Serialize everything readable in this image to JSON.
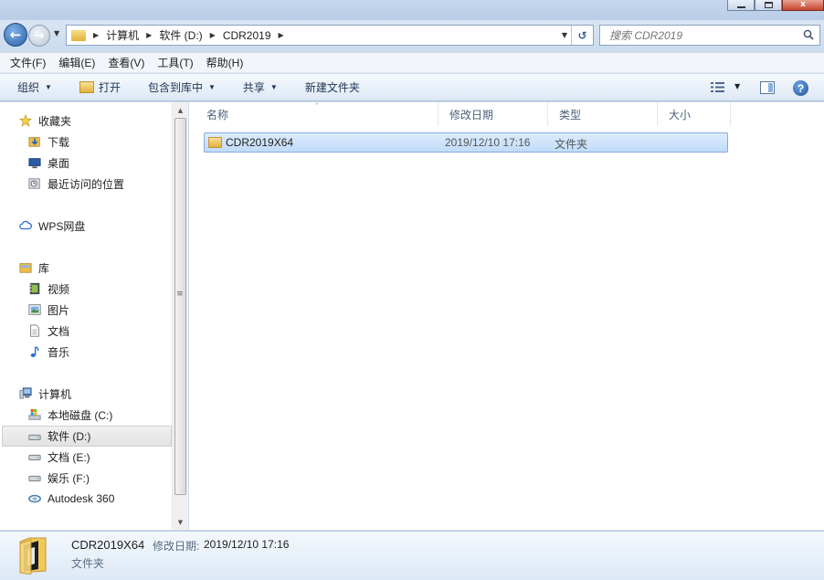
{
  "address": {
    "crumbs": [
      "计算机",
      "软件 (D:)",
      "CDR2019"
    ]
  },
  "search": {
    "placeholder": "搜索 CDR2019"
  },
  "menu": [
    "文件(F)",
    "编辑(E)",
    "查看(V)",
    "工具(T)",
    "帮助(H)"
  ],
  "toolbar": {
    "organize": "组织",
    "open": "打开",
    "include_library": "包含到库中",
    "share": "共享",
    "new_folder": "新建文件夹"
  },
  "nav": {
    "favorites": "收藏夹",
    "downloads": "下载",
    "desktop": "桌面",
    "recent": "最近访问的位置",
    "wps": "WPS网盘",
    "libraries": "库",
    "videos": "视频",
    "pictures": "图片",
    "documents": "文档",
    "music": "音乐",
    "computer": "计算机",
    "drive_c": "本地磁盘 (C:)",
    "drive_d": "软件 (D:)",
    "drive_e": "文档 (E:)",
    "drive_f": "娱乐 (F:)",
    "autodesk": "Autodesk 360"
  },
  "columns": {
    "name": "名称",
    "modified": "修改日期",
    "type": "类型",
    "size": "大小"
  },
  "files": [
    {
      "name": "CDR2019X64",
      "modified": "2019/12/10 17:16",
      "type": "文件夹",
      "size": ""
    }
  ],
  "details": {
    "name": "CDR2019X64",
    "modified_label": "修改日期:",
    "modified": "2019/12/10 17:16",
    "type": "文件夹"
  },
  "colors": {
    "selection": "#c1dcf9",
    "accent": "#2a5ea6"
  }
}
